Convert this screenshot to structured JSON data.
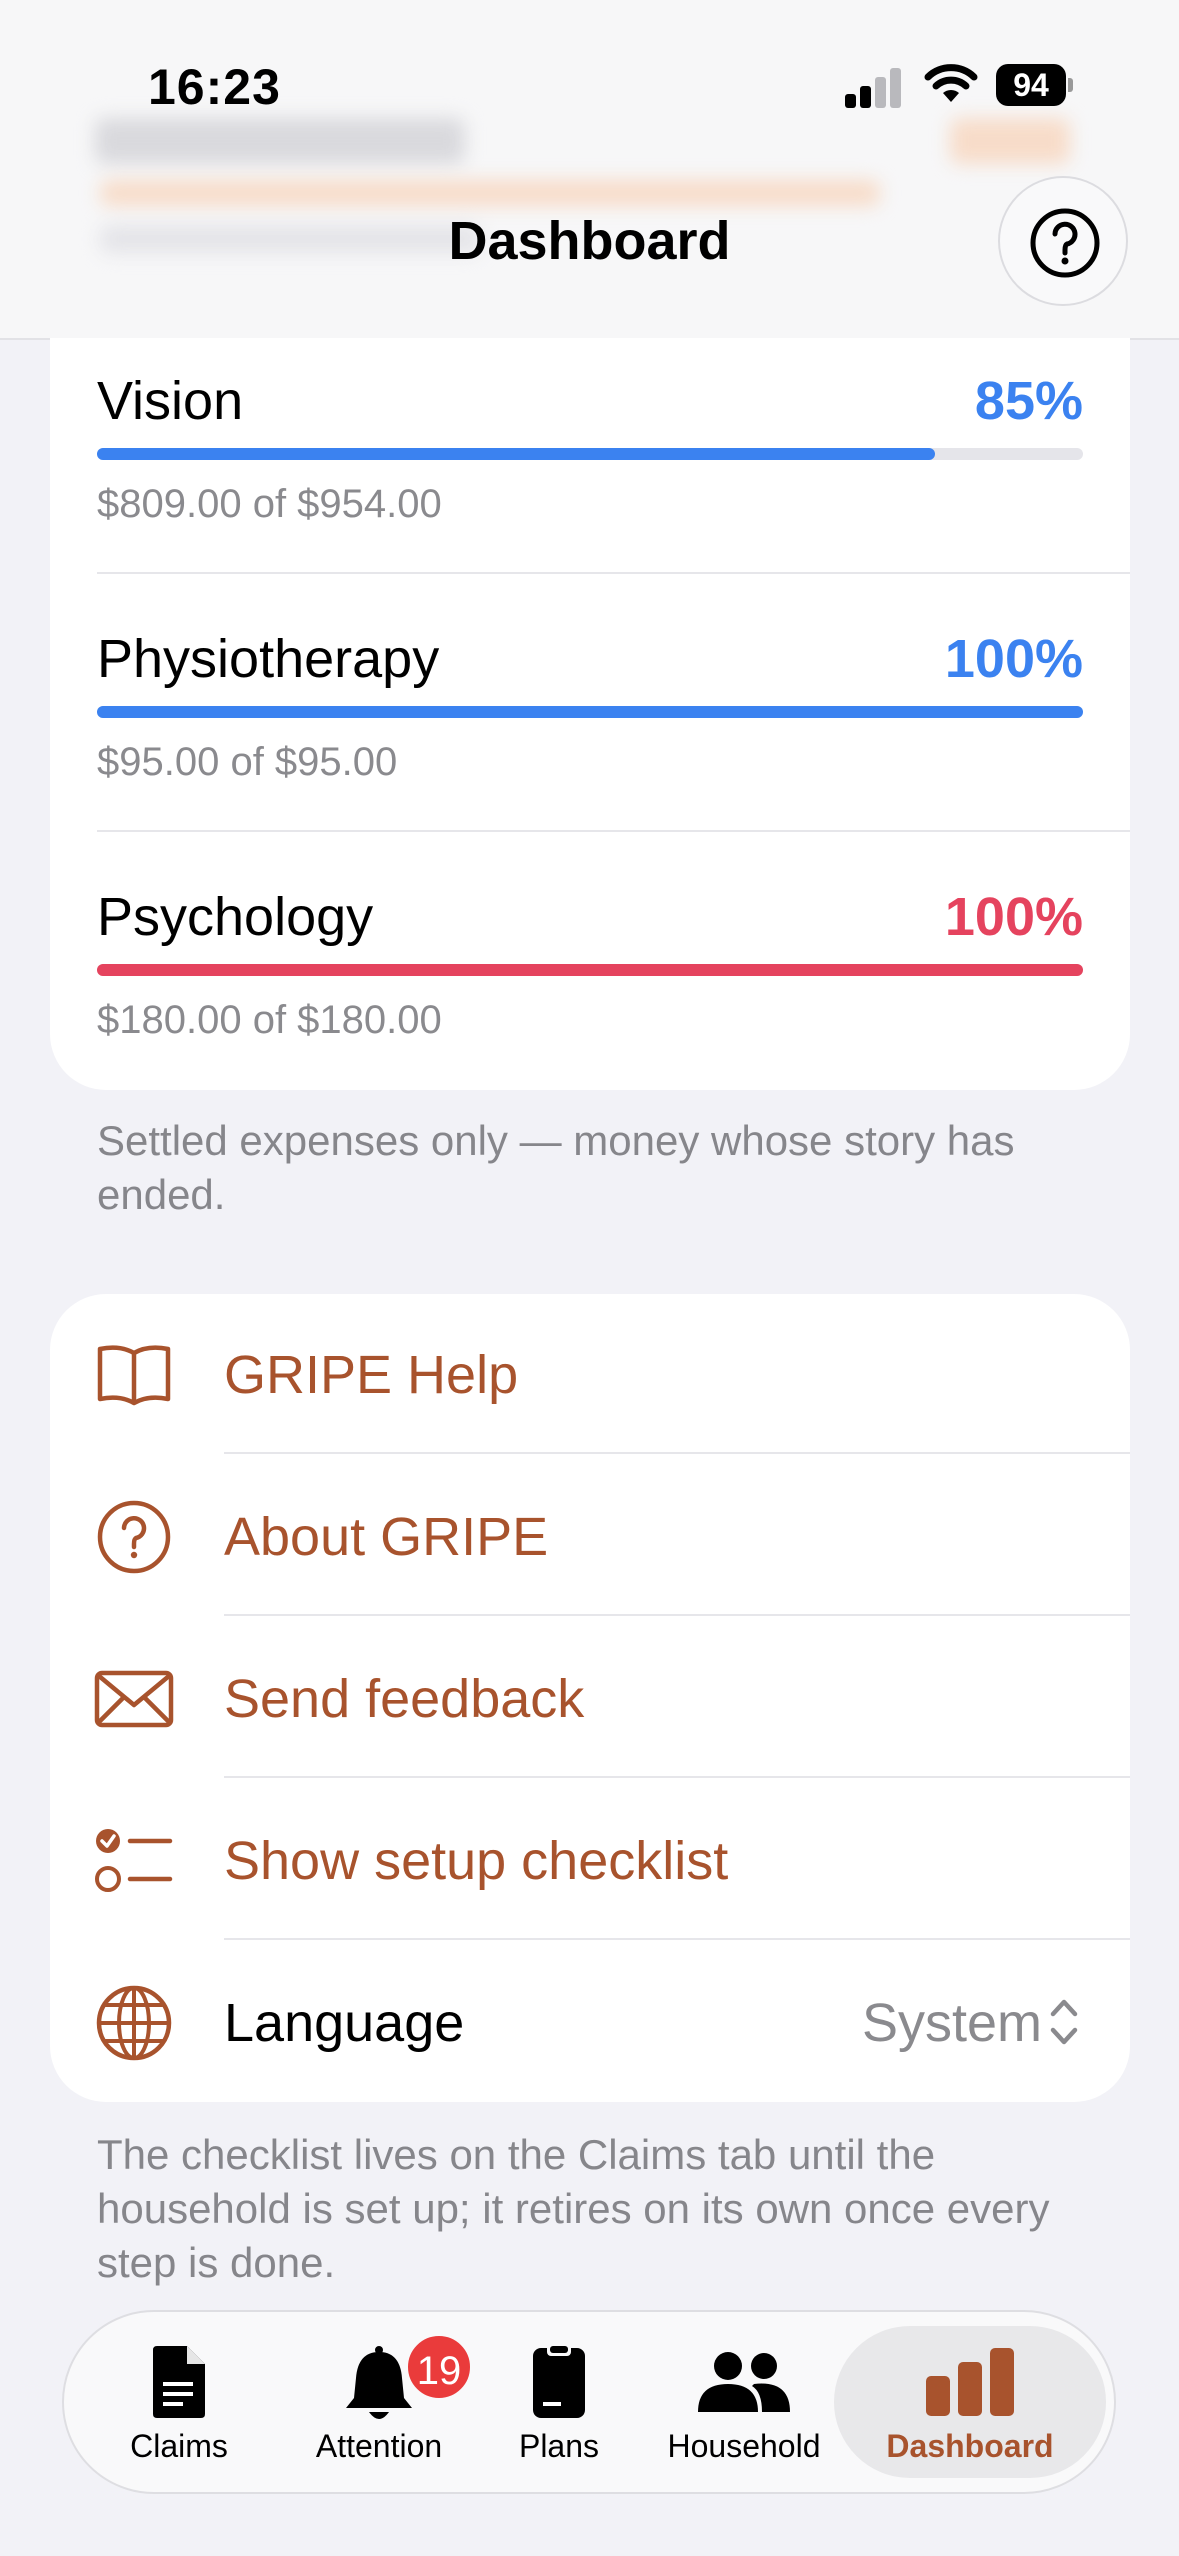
{
  "status_bar": {
    "time": "16:23",
    "battery": "94"
  },
  "header": {
    "title": "Dashboard"
  },
  "budget": {
    "categories": [
      {
        "name": "Vision",
        "percent_label": "85%",
        "fill": 0.85,
        "amount": "$809.00 of $954.00",
        "color": "#3b82f0"
      },
      {
        "name": "Physiotherapy",
        "percent_label": "100%",
        "fill": 1.0,
        "amount": "$95.00 of $95.00",
        "color": "#3b82f0"
      },
      {
        "name": "Psychology",
        "percent_label": "100%",
        "fill": 1.0,
        "amount": "$180.00 of $180.00",
        "color": "#e5435e"
      }
    ],
    "footnote": "Settled expenses only — money whose story has ended."
  },
  "menu": {
    "items": [
      {
        "label": "GRIPE Help",
        "icon": "book-icon"
      },
      {
        "label": "About GRIPE",
        "icon": "question-circle-icon"
      },
      {
        "label": "Send feedback",
        "icon": "envelope-icon"
      },
      {
        "label": "Show setup checklist",
        "icon": "checklist-icon"
      },
      {
        "label": "Language",
        "icon": "globe-icon",
        "value": "System"
      }
    ],
    "footnote": "The checklist lives on the Claims tab until the household is set up; it retires on its own once every step is done."
  },
  "tabbar": {
    "tabs": [
      {
        "label": "Claims",
        "icon": "document-icon"
      },
      {
        "label": "Attention",
        "icon": "bell-icon",
        "badge": "19"
      },
      {
        "label": "Plans",
        "icon": "clipboard-icon"
      },
      {
        "label": "Household",
        "icon": "people-icon"
      },
      {
        "label": "Dashboard",
        "icon": "bar-chart-icon",
        "active": true
      }
    ]
  },
  "colors": {
    "accent": "#a8532d",
    "blue": "#3b82f0",
    "red": "#e5435e",
    "badge": "#ea3b3b"
  }
}
